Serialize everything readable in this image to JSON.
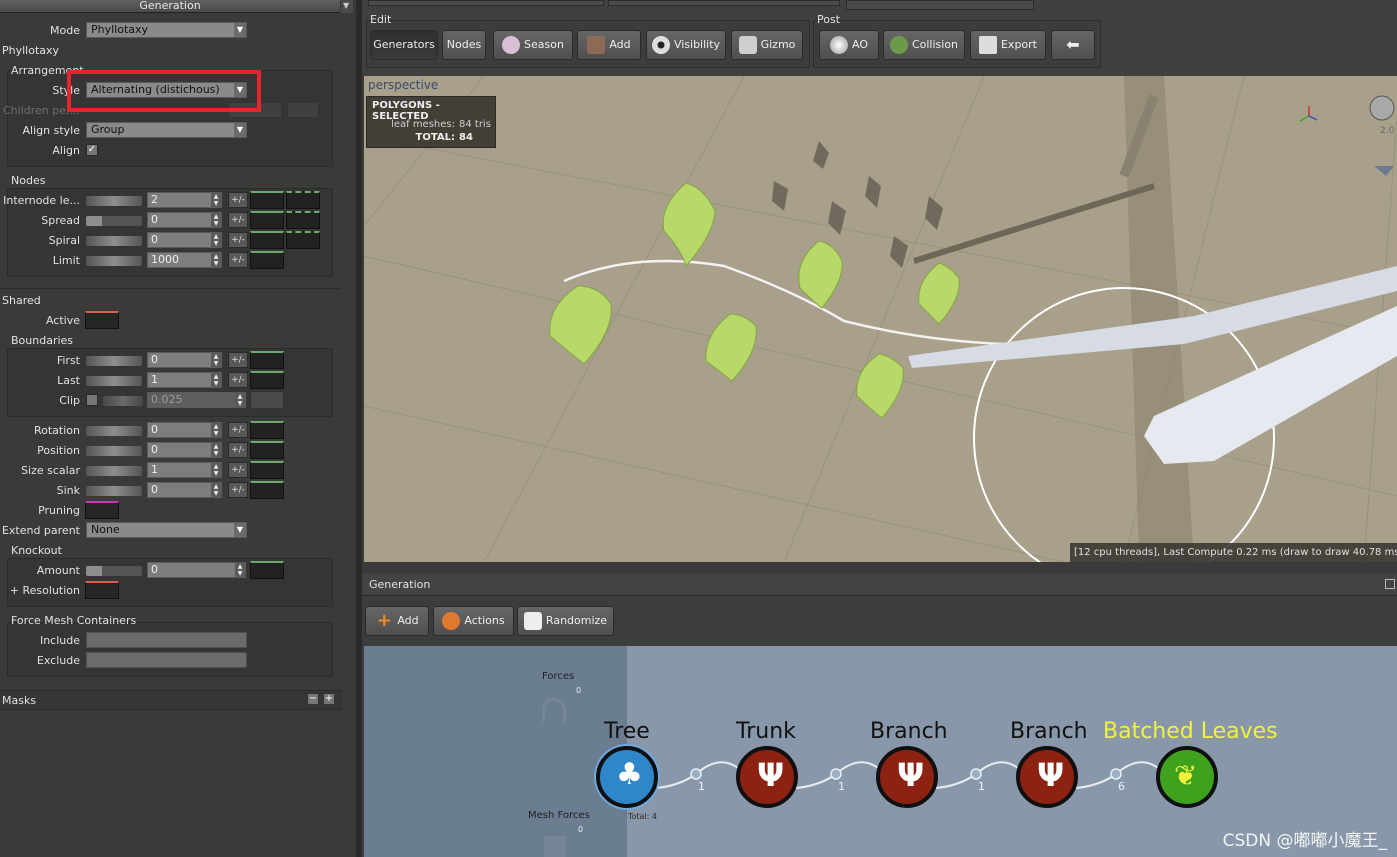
{
  "left_panel": {
    "title": "Generation",
    "mode": {
      "label": "Mode",
      "value": "Phyllotaxy"
    },
    "phyllotaxy_label": "Phyllotaxy",
    "arrangement": {
      "title": "Arrangement",
      "style_label": "Style",
      "style_value": "Alternating (distichous)",
      "children_label": "Children per...",
      "align_style_label": "Align style",
      "align_style_value": "Group",
      "align_label": "Align"
    },
    "nodes": {
      "title": "Nodes",
      "internode_label": "Internode le...",
      "internode_value": "2",
      "spread_label": "Spread",
      "spread_value": "0",
      "spiral_label": "Spiral",
      "spiral_value": "0",
      "limit_label": "Limit",
      "limit_value": "1000"
    },
    "shared_label": "Shared",
    "active_label": "Active",
    "boundaries": {
      "title": "Boundaries",
      "first_label": "First",
      "first_value": "0",
      "last_label": "Last",
      "last_value": "1",
      "clip_label": "Clip",
      "clip_value": "0.025"
    },
    "rotation_label": "Rotation",
    "rotation_value": "0",
    "position_label": "Position",
    "position_value": "0",
    "size_scalar_label": "Size scalar",
    "size_scalar_value": "1",
    "sink_label": "Sink",
    "sink_value": "0",
    "pruning_label": "Pruning",
    "extend_parent_label": "Extend parent",
    "extend_parent_value": "None",
    "knockout": {
      "title": "Knockout",
      "amount_label": "Amount",
      "amount_value": "0",
      "resolution_label": "+ Resolution"
    },
    "force_mesh": {
      "title": "Force Mesh Containers",
      "include_label": "Include",
      "exclude_label": "Exclude"
    },
    "masks_label": "Masks",
    "pm_label": "+/-"
  },
  "toolbar": {
    "edit_label": "Edit",
    "post_label": "Post",
    "buttons": {
      "generators": "Generators",
      "nodes": "Nodes",
      "season": "Season",
      "add": "Add",
      "visibility": "Visibility",
      "gizmo": "Gizmo",
      "ao": "AO",
      "collision": "Collision",
      "export": "Export"
    }
  },
  "viewport": {
    "camera_label": "perspective",
    "stats_title": "POLYGONS - SELECTED",
    "leaf_meshes_label": "leaf meshes:",
    "leaf_meshes_value": "84 tris",
    "total_label": "TOTAL:",
    "total_value": "84",
    "status_text": "[12 cpu threads], Last Compute 0.22 ms (draw to draw 40.78 ms",
    "zoom_value": "2.0"
  },
  "generation_panel": {
    "title": "Generation",
    "add_label": "Add",
    "actions_label": "Actions",
    "randomize_label": "Randomize",
    "forces_label": "Forces",
    "forces_count": "0",
    "mesh_forces_label": "Mesh Forces",
    "mesh_forces_count": "0",
    "total_label": "Total: 4",
    "nodes": [
      {
        "label": "Tree",
        "count": "1"
      },
      {
        "label": "Trunk",
        "count": "1"
      },
      {
        "label": "Branch",
        "count": "1"
      },
      {
        "label": "Branch",
        "count": "6"
      },
      {
        "label": "Batched Leaves"
      }
    ]
  },
  "watermark": "CSDN @嘟嘟小魔王_",
  "colors": {
    "highlight_box": "#e8242f",
    "batched_leaves_label": "#f2f23a",
    "tree_node": "#2f86c8",
    "branch_node": "#8b2212",
    "leaves_node": "#3fa21e"
  }
}
